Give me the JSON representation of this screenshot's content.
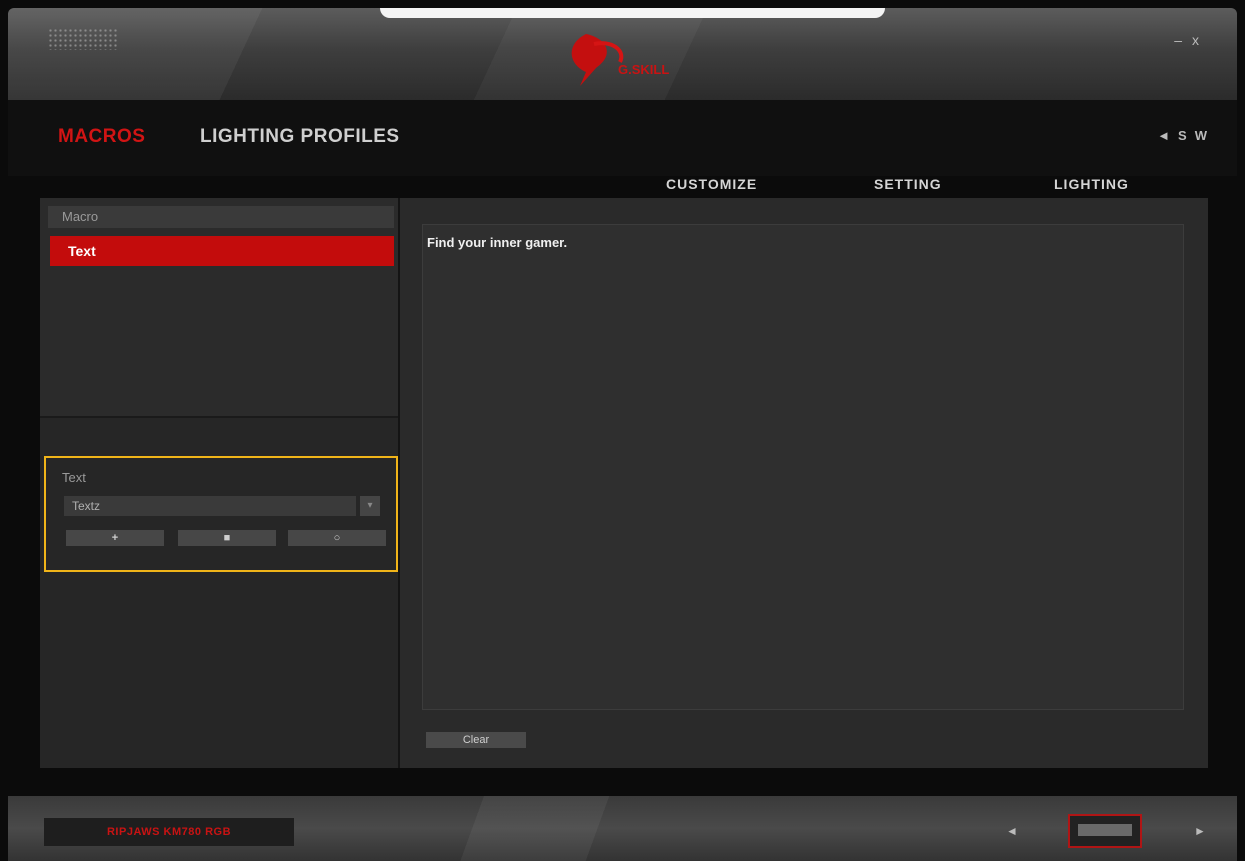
{
  "window": {
    "brand": "G.SKILL",
    "controls": {
      "minimize": "–",
      "close": "x"
    }
  },
  "nav": {
    "main_tabs": [
      {
        "label": "MACROS",
        "active": true
      },
      {
        "label": "LIGHTING PROFILES",
        "active": false
      }
    ],
    "lang": {
      "back": "◄",
      "a": "S",
      "b": "W"
    },
    "sub_tabs": [
      "CUSTOMIZE",
      "SETTING",
      "LIGHTING"
    ]
  },
  "macro_list": {
    "header": "Macro",
    "selected_item": "Text"
  },
  "macro_editor": {
    "label": "Text",
    "input_value": "Textz",
    "dropdown_icon": "▾",
    "buttons": {
      "add": "+",
      "delete": "■",
      "reset": "○"
    }
  },
  "text_panel": {
    "content": "Find your inner gamer.",
    "clear_label": "Clear"
  },
  "device": {
    "name": "RIPJAWS KM780 RGB",
    "prev": "◄",
    "next": "►"
  },
  "colors": {
    "accent_red": "#c30c0c",
    "highlight_border": "#f0b419"
  }
}
